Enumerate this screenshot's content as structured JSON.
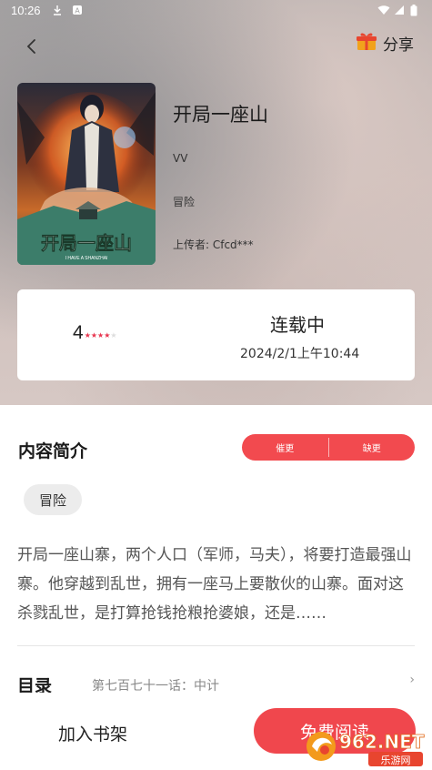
{
  "status_bar": {
    "time": "10:26",
    "icons_left": [
      "download-icon",
      "app-a-icon"
    ],
    "icons_right": [
      "wifi-icon",
      "signal-icon",
      "battery-icon"
    ]
  },
  "header": {
    "back_icon": "chevron-left-icon",
    "share_label": "分享",
    "share_icon": "gift-icon"
  },
  "book": {
    "cover_title_art": "开局一座山",
    "cover_subtitle_art": "I HAVE A SHANZHAI",
    "title": "开局一座山",
    "author": "VV",
    "genre": "冒险",
    "uploader": "上传者: Cfcd***"
  },
  "info_card": {
    "rating_value": "4",
    "rating_stars": "★★★★",
    "rating_empty_star": "★",
    "status": "连载中",
    "updated": "2024/2/1上午10:44"
  },
  "intro": {
    "title": "内容简介",
    "urge_label": "催更",
    "report_label": "缺更",
    "tag": "冒险",
    "synopsis": "开局一座山寨，两个人口（军师，马夫），将要打造最强山寨。他穿越到乱世，拥有一座马上要散伙的山寨。面对这杀戮乱世，是打算抢钱抢粮抢婆娘，还是……"
  },
  "catalog": {
    "label": "目录",
    "latest_chapter": "第七百七十一话：中计",
    "arrow": "›"
  },
  "bottom": {
    "add_shelf_label": "加入书架",
    "read_label": "免费阅读"
  },
  "watermark": {
    "brand": "962.NET",
    "sub": "乐游网"
  },
  "colors": {
    "accent": "#f0474d",
    "star": "#e8344e"
  }
}
